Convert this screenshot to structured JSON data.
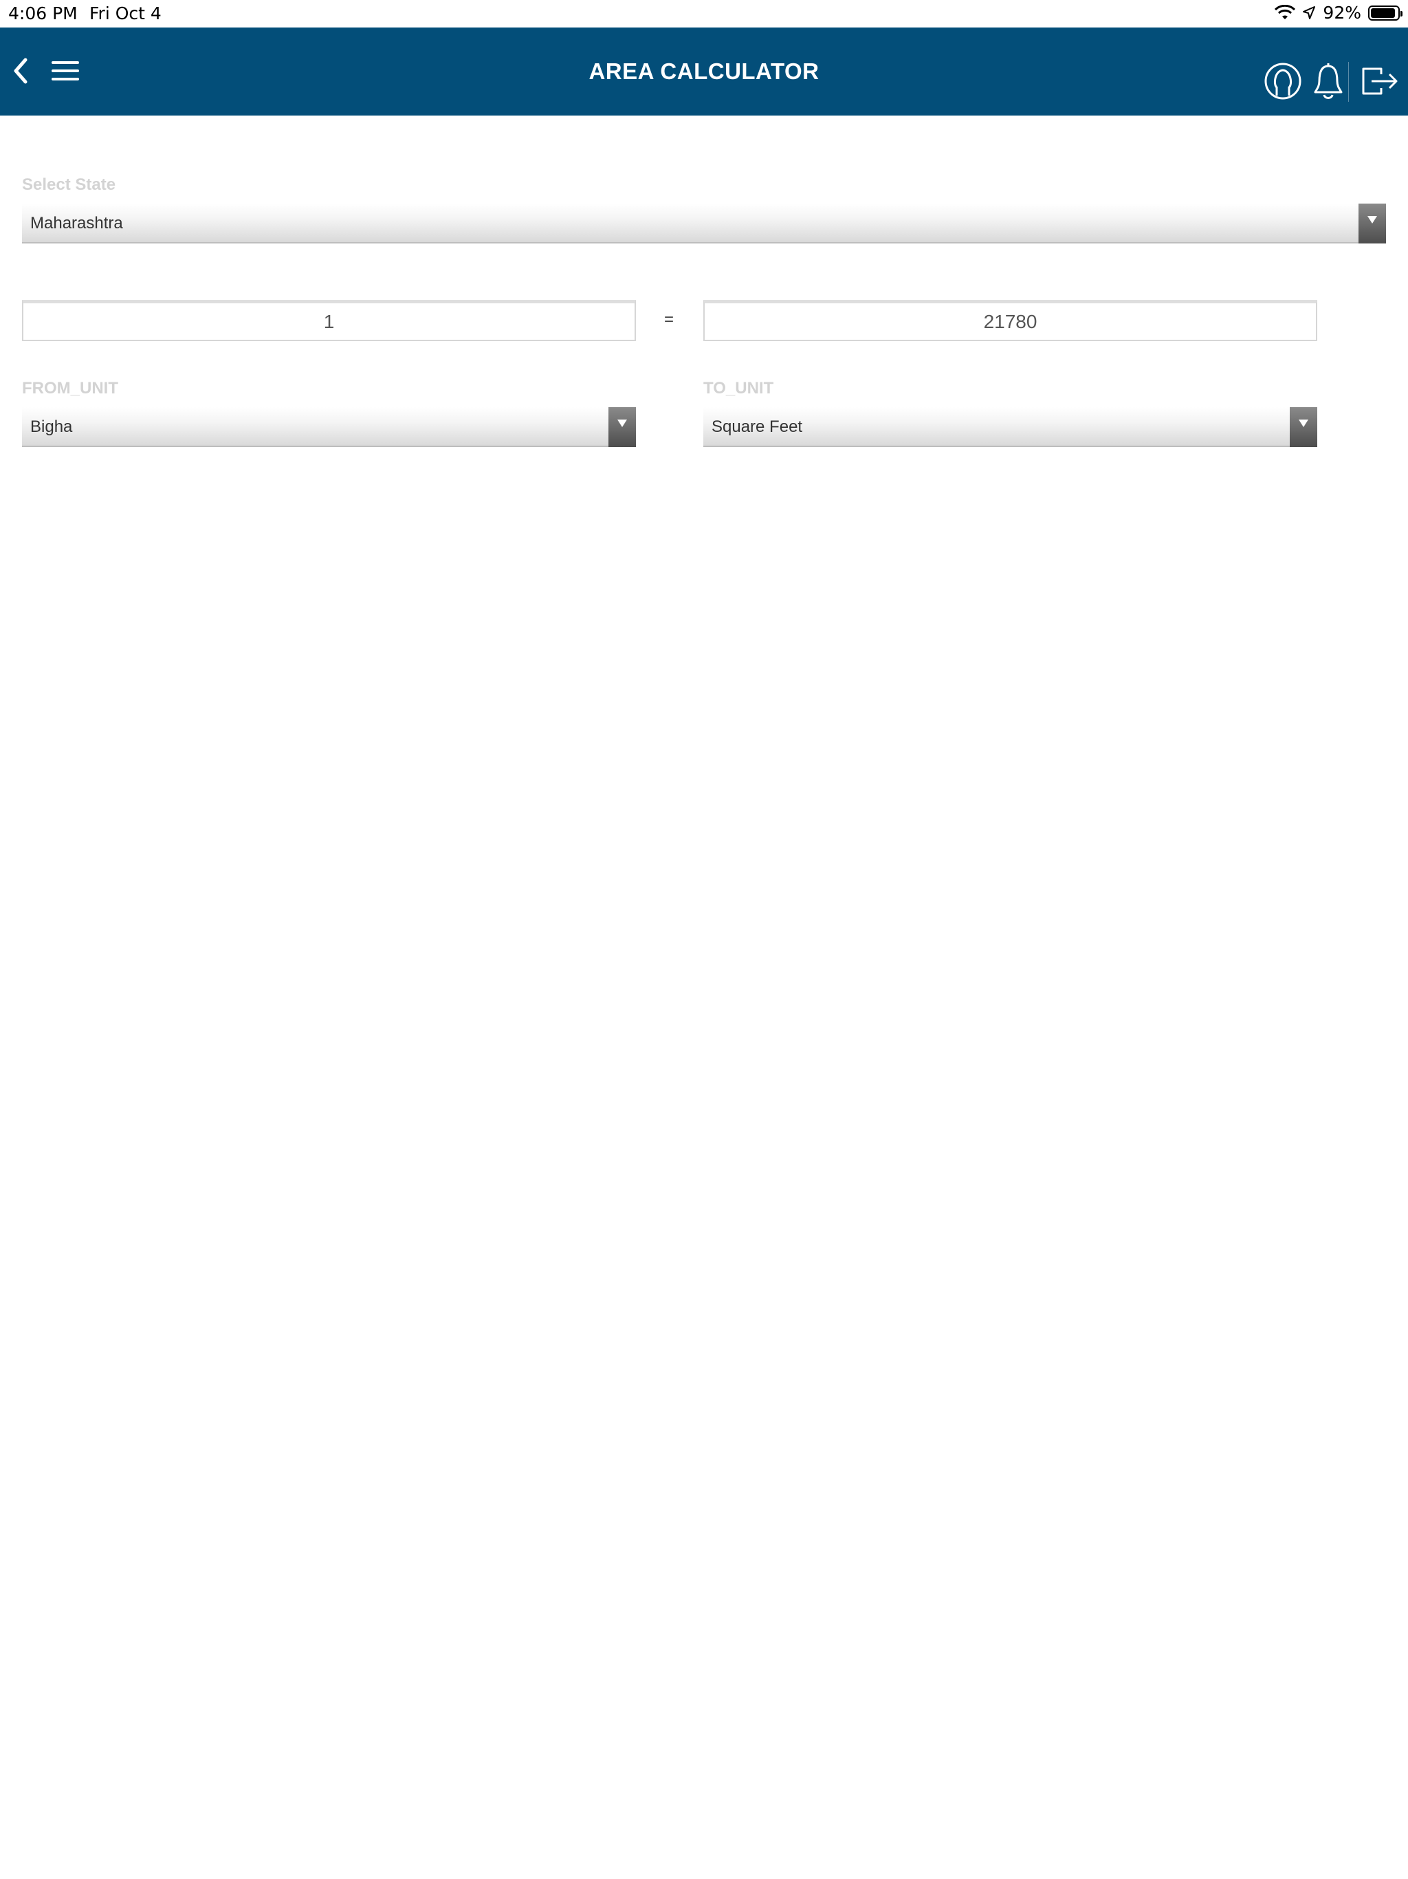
{
  "status_bar": {
    "time": "4:06 PM",
    "date": "Fri Oct 4",
    "battery_percent": "92%",
    "battery_level": 0.92
  },
  "header": {
    "title": "AREA CALCULATOR",
    "background_color": "#034e79",
    "icons": [
      "back-chevron-icon",
      "hamburger-menu-icon",
      "user-profile-icon",
      "bell-icon",
      "logout-icon"
    ]
  },
  "state_select": {
    "label": "Select State",
    "value": "Maharashtra"
  },
  "conversion": {
    "from_value": "1",
    "equals": "=",
    "to_value": "21780",
    "from_unit_label": "FROM_UNIT",
    "from_unit_value": "Bigha",
    "to_unit_label": "TO_UNIT",
    "to_unit_value": "Square Feet"
  }
}
